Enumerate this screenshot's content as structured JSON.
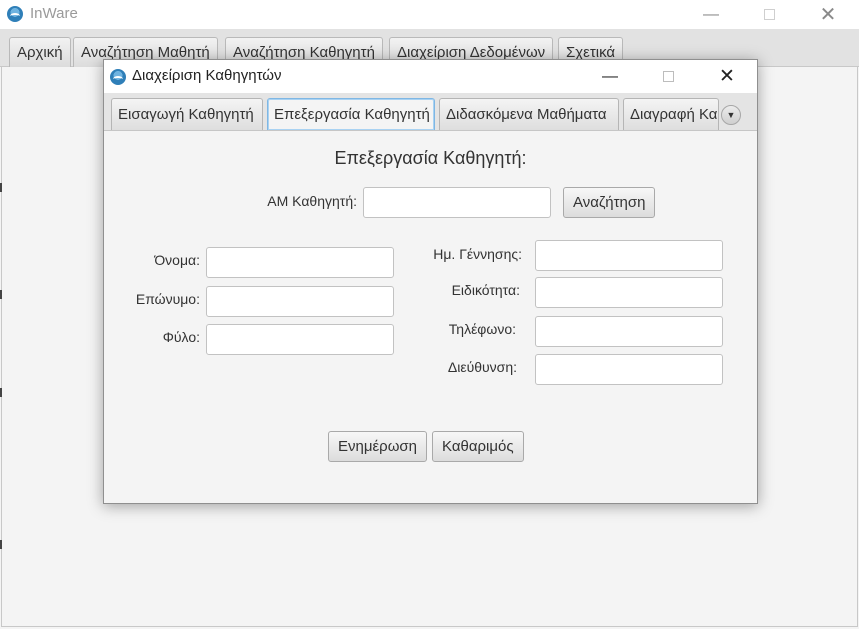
{
  "app": {
    "title": "InWare"
  },
  "main_tabs": [
    {
      "label": "Αρχική"
    },
    {
      "label": "Αναζήτηση Μαθητή"
    },
    {
      "label": "Αναζήτηση Καθηγητή"
    },
    {
      "label": "Διαχείριση Δεδομένων"
    },
    {
      "label": "Σχετικά"
    }
  ],
  "dialog": {
    "title": "Διαχείριση Καθηγητών",
    "tabs": [
      {
        "label": "Εισαγωγή Καθηγητή"
      },
      {
        "label": "Επεξεργασία Καθηγητή"
      },
      {
        "label": "Διδασκόμενα Μαθήματα"
      },
      {
        "label": "Διαγραφή Καθηγητή"
      }
    ],
    "selected_tab": "Επεξεργασία Καθηγητή",
    "form": {
      "heading": "Επεξεργασία Καθηγητή:",
      "am_label": "ΑΜ Καθηγητή:",
      "am_value": "",
      "search_button": "Αναζήτηση",
      "left_fields": [
        {
          "label": "Όνομα:",
          "value": ""
        },
        {
          "label": "Επώνυμο:",
          "value": ""
        },
        {
          "label": "Φύλο:",
          "value": ""
        }
      ],
      "right_fields": [
        {
          "label": "Ημ. Γέννησης:",
          "value": ""
        },
        {
          "label": "Ειδικότητα:",
          "value": ""
        },
        {
          "label": "Τηλέφωνο:",
          "value": ""
        },
        {
          "label": "Διεύθυνση:",
          "value": ""
        }
      ],
      "update_button": "Ενημέρωση",
      "clear_button": "Καθαριμός"
    }
  },
  "icons": {
    "app": "app-logo-icon",
    "minimize": "minimize-icon",
    "maximize": "maximize-icon",
    "close": "close-icon",
    "tab_overflow": "chevron-down-icon"
  },
  "colors": {
    "selected_tab_border": "#7fb7e4",
    "background": "#f4f4f4"
  }
}
